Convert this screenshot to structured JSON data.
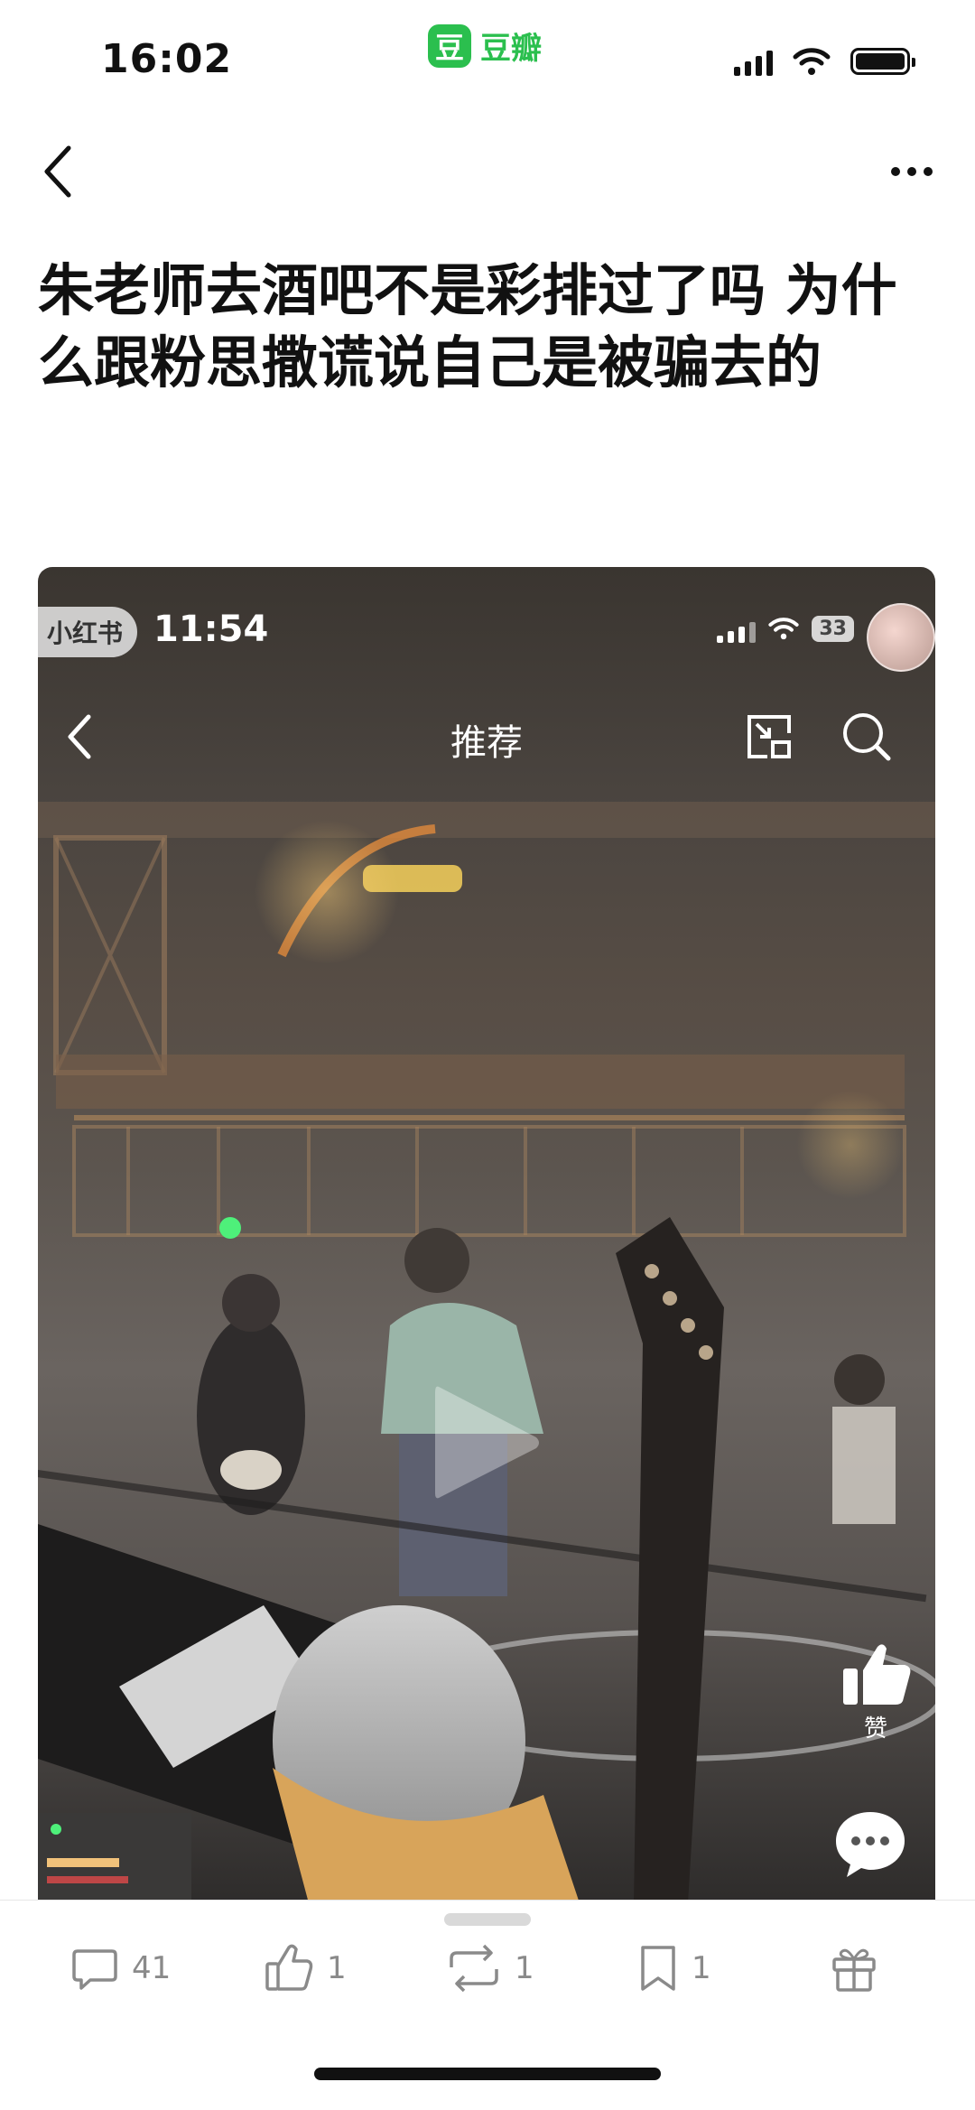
{
  "status_bar": {
    "time": "16:02",
    "app_logo_char": "豆",
    "app_name": "豆瓣"
  },
  "post": {
    "title": "朱老师去酒吧不是彩排过了吗 为什么跟粉思撒谎说自己是被骗去的"
  },
  "video": {
    "source_badge": "小红书",
    "time": "11:54",
    "battery": "33",
    "nav_title": "推荐",
    "like_label": "赞"
  },
  "actions": {
    "comments": "41",
    "likes": "1",
    "reshares": "1",
    "collections": "1"
  },
  "colors": {
    "brand_green": "#2bbf4e",
    "icon_gray": "#8a8a8a"
  }
}
